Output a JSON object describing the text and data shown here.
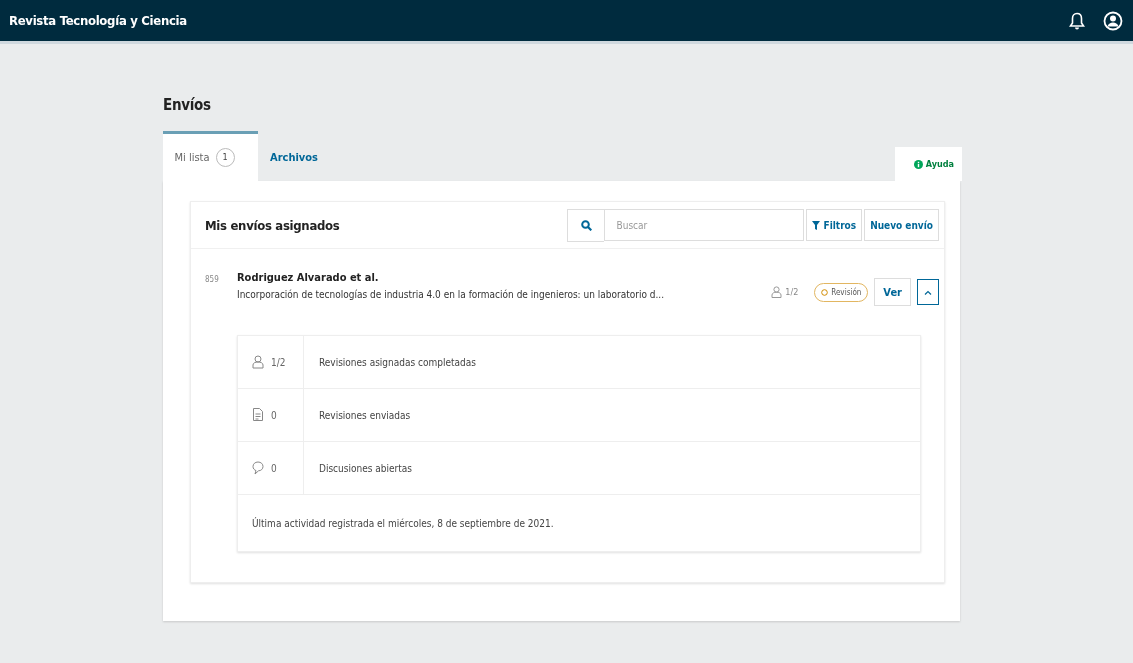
{
  "header": {
    "title": "Revista Tecnología y Ciencia"
  },
  "page_title": "Envíos",
  "tabs": [
    {
      "label": "Mi lista",
      "count": "1",
      "selected": true
    },
    {
      "label": "Archivos",
      "selected": false
    }
  ],
  "help_button": "Ayuda",
  "list": {
    "title": "Mis envíos asignados",
    "search": {
      "placeholder": "Buscar"
    },
    "filter_button": "Filtros",
    "new_button": "Nuevo envío"
  },
  "submission": {
    "id": "859",
    "authors": "Rodriguez Alvarado et al.",
    "title": "Incorporación de tecnologías de industria 4.0 en la formación de ingenieros: un laboratorio d...",
    "reviews": "1/2",
    "stage": "Revisión",
    "view_button": "Ver",
    "expanded": true,
    "details": [
      {
        "kind": "reviews",
        "value": "1/2",
        "label": "Revisiones asignadas completadas"
      },
      {
        "kind": "files",
        "value": "0",
        "label": "Revisiones enviadas"
      },
      {
        "kind": "discussions",
        "value": "0",
        "label": "Discusiones abiertas"
      }
    ],
    "last_activity": "Última actividad registrada el miércoles, 8 de septiembre de 2021."
  }
}
